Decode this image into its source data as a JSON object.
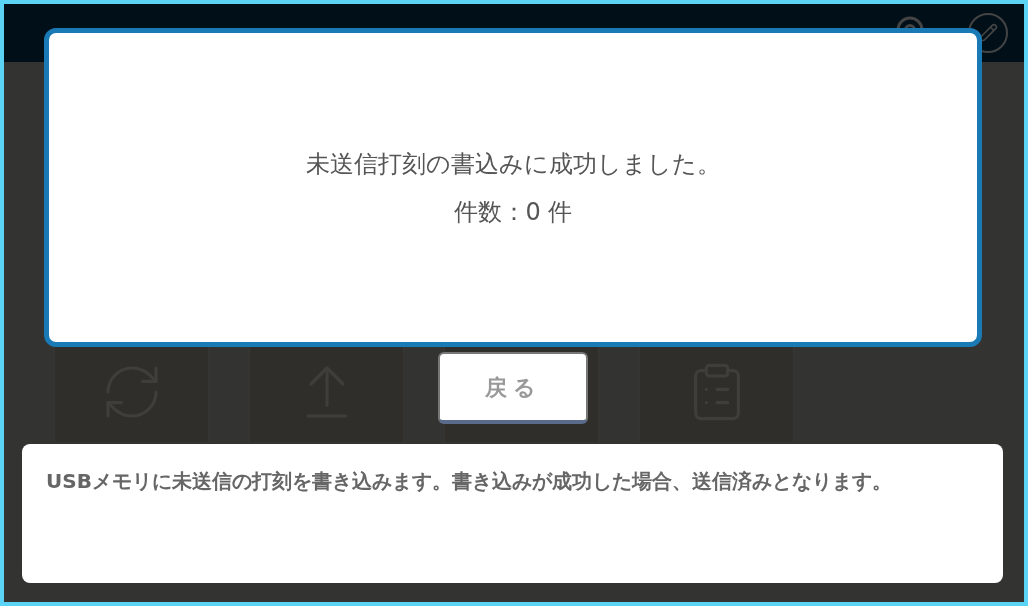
{
  "dialog": {
    "lines": [
      "未送信打刻の書込みに成功しました。",
      "件数：0 件"
    ]
  },
  "back_button": {
    "label": "戻る"
  },
  "help": {
    "text": "USBメモリに未送信の打刻を書き込みます。書き込みが成功した場合、送信済みとなります。"
  }
}
